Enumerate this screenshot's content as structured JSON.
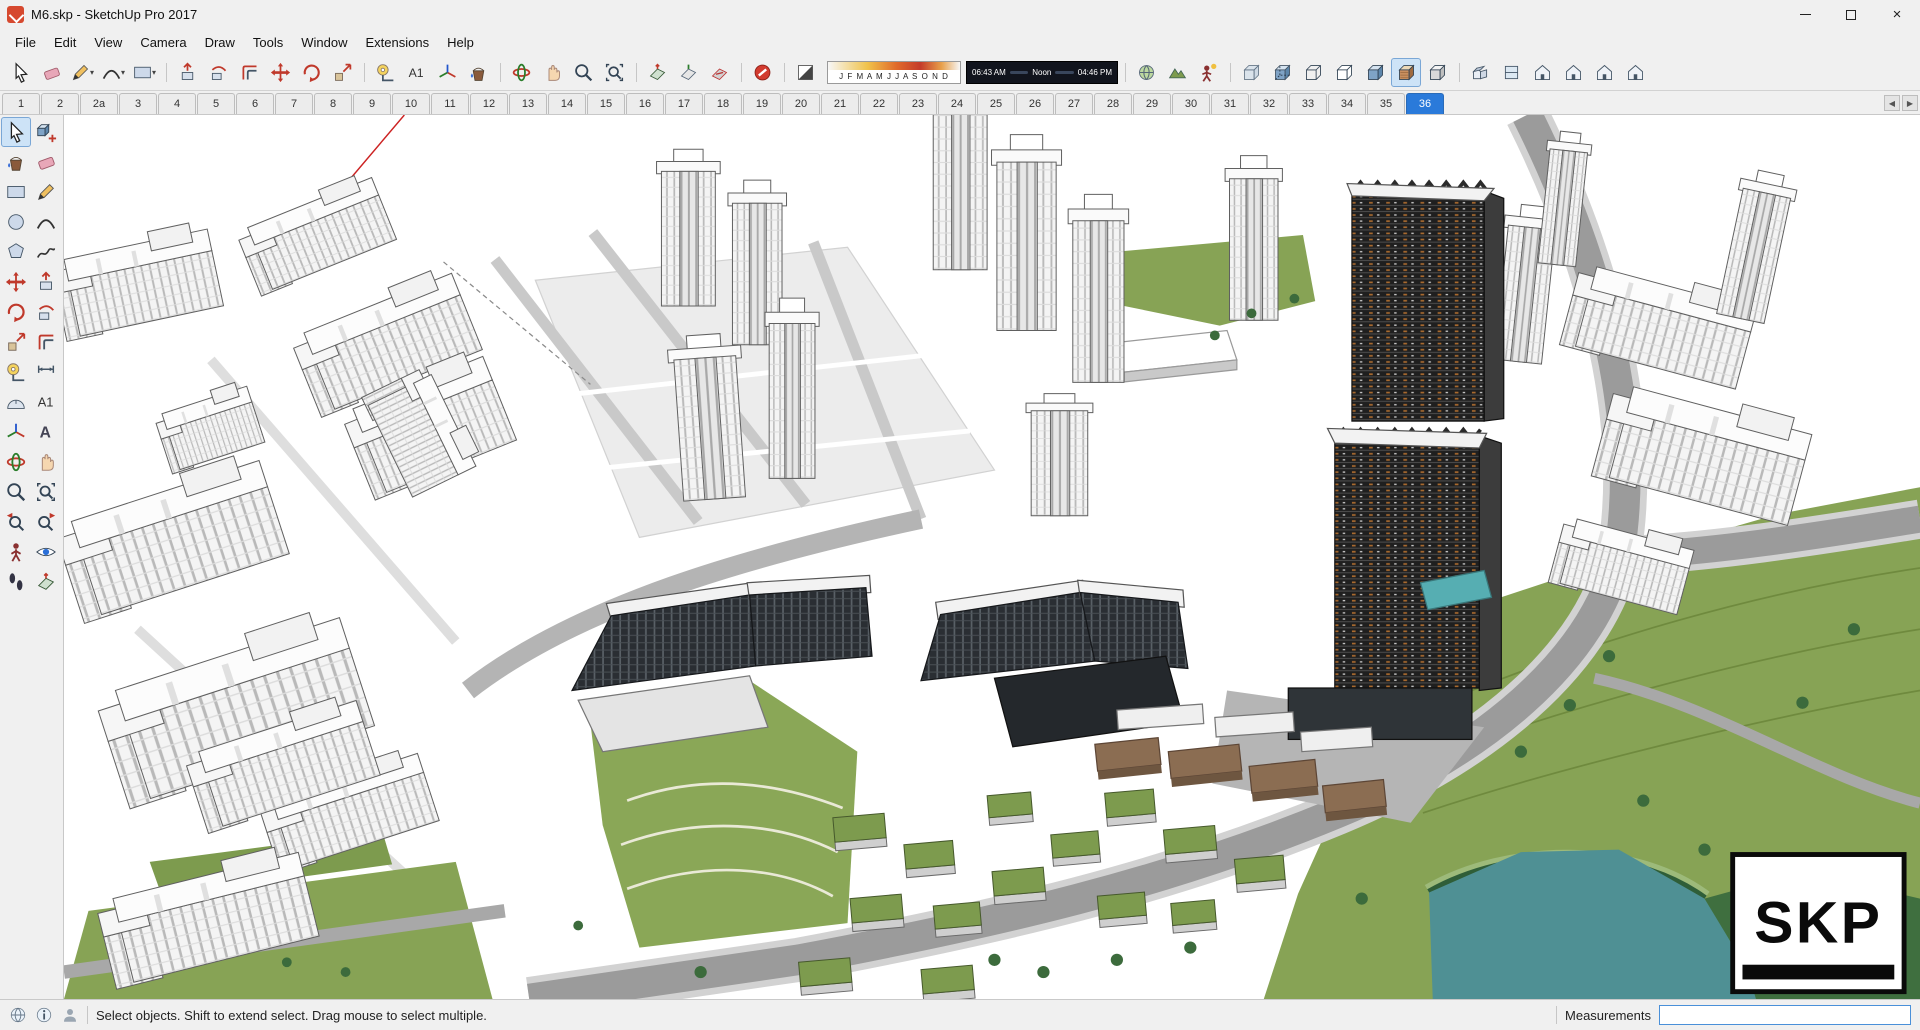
{
  "window": {
    "title": "M6.skp - SketchUp Pro 2017",
    "close_glyph": "×"
  },
  "menu": {
    "items": [
      {
        "id": "menu-file",
        "label": "File"
      },
      {
        "id": "menu-edit",
        "label": "Edit"
      },
      {
        "id": "menu-view",
        "label": "View"
      },
      {
        "id": "menu-camera",
        "label": "Camera"
      },
      {
        "id": "menu-draw",
        "label": "Draw"
      },
      {
        "id": "menu-tools",
        "label": "Tools"
      },
      {
        "id": "menu-window",
        "label": "Window"
      },
      {
        "id": "menu-extensions",
        "label": "Extensions"
      },
      {
        "id": "menu-help",
        "label": "Help"
      }
    ]
  },
  "toolbar": {
    "buttons_a": [
      {
        "name": "select-button",
        "icon": "#i-cursor",
        "icon_name": "cursor-icon"
      },
      {
        "name": "eraser-button",
        "icon": "#i-eraser",
        "icon_name": "eraser-icon"
      },
      {
        "name": "line-button",
        "icon": "#i-pencil",
        "icon_name": "pencil-icon",
        "dropdown": true
      },
      {
        "name": "arcs-button",
        "icon": "#i-arc",
        "icon_name": "arc-icon",
        "dropdown": true
      },
      {
        "name": "shapes-button",
        "icon": "#i-rect",
        "icon_name": "rectangle-icon",
        "dropdown": true
      },
      {
        "name": "push-pull-button",
        "icon": "#i-pushpull",
        "icon_name": "push-pull-icon",
        "sep": true
      },
      {
        "name": "follow-me-button",
        "icon": "#i-followme",
        "icon_name": "follow-me-icon"
      },
      {
        "name": "offset-button",
        "icon": "#i-offset",
        "icon_name": "offset-icon"
      },
      {
        "name": "move-button",
        "icon": "#i-move",
        "icon_name": "move-icon"
      },
      {
        "name": "rotate-button",
        "icon": "#i-rotate",
        "icon_name": "rotate-icon"
      },
      {
        "name": "scale-button",
        "icon": "#i-scale",
        "icon_name": "scale-icon"
      },
      {
        "name": "tape-measure-button",
        "icon": "#i-tape",
        "icon_name": "tape-measure-icon",
        "sep": true
      },
      {
        "name": "text-button",
        "icon": "#i-text",
        "icon_name": "text-icon"
      },
      {
        "name": "axes-button",
        "icon": "#i-axes",
        "icon_name": "axes-icon"
      },
      {
        "name": "paint-bucket-button",
        "icon": "#i-bucket",
        "icon_name": "paint-bucket-icon"
      },
      {
        "name": "orbit-button",
        "icon": "#i-orbit",
        "icon_name": "orbit-icon",
        "sep": true
      },
      {
        "name": "pan-button",
        "icon": "#i-pan",
        "icon_name": "pan-icon"
      },
      {
        "name": "zoom-button",
        "icon": "#i-zoom",
        "icon_name": "zoom-icon"
      },
      {
        "name": "zoom-extents-button",
        "icon": "#i-zoomext",
        "icon_name": "zoom-extents-icon"
      },
      {
        "name": "section-plane-button",
        "icon": "#i-section",
        "icon_name": "section-plane-icon",
        "sep": true
      },
      {
        "name": "section-display-button",
        "icon": "#i-secdisp",
        "icon_name": "section-display-icon"
      },
      {
        "name": "section-cuts-button",
        "icon": "#i-seccut",
        "icon_name": "section-cuts-icon"
      },
      {
        "name": "render-plugin-button",
        "icon": "#i-red",
        "icon_name": "red-badge-icon",
        "sep": true
      },
      {
        "name": "shadow-settings-button",
        "icon": "#i-shadowbox",
        "icon_name": "shadow-toggle-icon",
        "sep": true
      }
    ],
    "shadow": {
      "months": "J F M A M J J A S O N D",
      "time_start": "06:43 AM",
      "time_noon": "Noon",
      "time_end": "04:46 PM"
    },
    "buttons_b": [
      {
        "name": "add-location-button",
        "icon": "#i-geoloc",
        "icon_name": "globe-icon",
        "sep": true
      },
      {
        "name": "toggle-terrain-button",
        "icon": "#i-terrain",
        "icon_name": "terrain-icon"
      },
      {
        "name": "photo-textures-button",
        "icon": "#i-photo",
        "icon_name": "photo-person-icon"
      },
      {
        "name": "style-xray-button",
        "icon": "#i-xray",
        "icon_name": "xray-cube-icon",
        "sep": true
      },
      {
        "name": "style-back-edges-button",
        "icon": "#i-backedge",
        "icon_name": "back-edges-cube-icon"
      },
      {
        "name": "style-wireframe-button",
        "icon": "#i-wire",
        "icon_name": "wireframe-cube-icon"
      },
      {
        "name": "style-hidden-line-button",
        "icon": "#i-hidden",
        "icon_name": "hidden-line-cube-icon"
      },
      {
        "name": "style-shaded-button",
        "icon": "#i-shaded",
        "icon_name": "shaded-cube-icon"
      },
      {
        "name": "style-shaded-textures-button",
        "icon": "#i-textured",
        "icon_name": "textured-cube-icon",
        "pressed": true
      },
      {
        "name": "style-monochrome-button",
        "icon": "#i-mono",
        "icon_name": "monochrome-cube-icon"
      },
      {
        "name": "view-iso-button",
        "icon": "#i-viewiso",
        "icon_name": "iso-house-icon",
        "sep": true
      },
      {
        "name": "view-top-button",
        "icon": "#i-viewtop",
        "icon_name": "top-plan-icon"
      },
      {
        "name": "view-front-button",
        "icon": "#i-house",
        "icon_name": "front-house-icon"
      },
      {
        "name": "view-right-button",
        "icon": "#i-house",
        "icon_name": "right-house-icon"
      },
      {
        "name": "view-back-button",
        "icon": "#i-house",
        "icon_name": "back-house-icon"
      },
      {
        "name": "view-left-button",
        "icon": "#i-house",
        "icon_name": "left-house-icon"
      }
    ]
  },
  "scene_tabs": {
    "scroll_left": "◀",
    "scroll_right": "▶",
    "tabs": [
      {
        "label": "1"
      },
      {
        "label": "2"
      },
      {
        "label": "2a"
      },
      {
        "label": "3"
      },
      {
        "label": "4"
      },
      {
        "label": "5"
      },
      {
        "label": "6"
      },
      {
        "label": "7"
      },
      {
        "label": "8"
      },
      {
        "label": "9"
      },
      {
        "label": "10"
      },
      {
        "label": "11"
      },
      {
        "label": "12"
      },
      {
        "label": "13"
      },
      {
        "label": "14"
      },
      {
        "label": "15"
      },
      {
        "label": "16"
      },
      {
        "label": "17"
      },
      {
        "label": "18"
      },
      {
        "label": "19"
      },
      {
        "label": "20"
      },
      {
        "label": "21"
      },
      {
        "label": "22"
      },
      {
        "label": "23"
      },
      {
        "label": "24"
      },
      {
        "label": "25"
      },
      {
        "label": "26"
      },
      {
        "label": "27"
      },
      {
        "label": "28"
      },
      {
        "label": "29"
      },
      {
        "label": "30"
      },
      {
        "label": "31"
      },
      {
        "label": "32"
      },
      {
        "label": "33"
      },
      {
        "label": "34"
      },
      {
        "label": "35"
      },
      {
        "label": "36",
        "active": true
      }
    ]
  },
  "palette": {
    "tools": [
      {
        "name": "palette-select-button",
        "icon": "#i-cursor",
        "icon_name": "cursor-icon",
        "pressed": true
      },
      {
        "name": "palette-make-component-button",
        "icon": "#i-component",
        "icon_name": "component-icon"
      },
      {
        "name": "palette-paint-bucket-button",
        "icon": "#i-bucket",
        "icon_name": "paint-bucket-icon"
      },
      {
        "name": "palette-eraser-button",
        "icon": "#i-eraser",
        "icon_name": "eraser-icon"
      },
      {
        "name": "palette-rectangle-button",
        "icon": "#i-rect",
        "icon_name": "rectangle-icon"
      },
      {
        "name": "palette-line-button",
        "icon": "#i-pencil",
        "icon_name": "pencil-icon"
      },
      {
        "name": "palette-circle-button",
        "icon": "#i-circle",
        "icon_name": "circle-icon"
      },
      {
        "name": "palette-arc-button",
        "icon": "#i-arc",
        "icon_name": "arc-icon"
      },
      {
        "name": "palette-polygon-button",
        "icon": "#i-polygon",
        "icon_name": "polygon-icon"
      },
      {
        "name": "palette-freehand-button",
        "icon": "#i-freehand",
        "icon_name": "freehand-icon"
      },
      {
        "name": "palette-move-button",
        "icon": "#i-move",
        "icon_name": "move-icon"
      },
      {
        "name": "palette-push-pull-button",
        "icon": "#i-pushpull",
        "icon_name": "push-pull-icon"
      },
      {
        "name": "palette-rotate-button",
        "icon": "#i-rotate",
        "icon_name": "rotate-icon"
      },
      {
        "name": "palette-follow-me-button",
        "icon": "#i-followme",
        "icon_name": "follow-me-icon"
      },
      {
        "name": "palette-scale-button",
        "icon": "#i-scale",
        "icon_name": "scale-icon"
      },
      {
        "name": "palette-offset-button",
        "icon": "#i-offset",
        "icon_name": "offset-icon"
      },
      {
        "name": "palette-tape-measure-button",
        "icon": "#i-tape",
        "icon_name": "tape-measure-icon"
      },
      {
        "name": "palette-dimension-button",
        "icon": "#i-dim",
        "icon_name": "dimension-icon"
      },
      {
        "name": "palette-protractor-button",
        "icon": "#i-protract",
        "icon_name": "protractor-icon"
      },
      {
        "name": "palette-text-button",
        "icon": "#i-text",
        "icon_name": "text-icon"
      },
      {
        "name": "palette-axes-button",
        "icon": "#i-axes",
        "icon_name": "axes-icon"
      },
      {
        "name": "palette-3d-text-button",
        "icon": "#i-3dtext",
        "icon_name": "3d-text-icon"
      },
      {
        "name": "palette-orbit-button",
        "icon": "#i-orbit",
        "icon_name": "orbit-icon"
      },
      {
        "name": "palette-pan-button",
        "icon": "#i-pan",
        "icon_name": "pan-icon"
      },
      {
        "name": "palette-zoom-button",
        "icon": "#i-zoom",
        "icon_name": "zoom-icon"
      },
      {
        "name": "palette-zoom-extents-button",
        "icon": "#i-zoomext",
        "icon_name": "zoom-extents-icon"
      },
      {
        "name": "palette-zoom-previous-button",
        "icon": "#i-zoomprev",
        "icon_name": "zoom-previous-icon"
      },
      {
        "name": "palette-zoom-next-button",
        "icon": "#i-zoomnext",
        "icon_name": "zoom-next-icon"
      },
      {
        "name": "palette-position-camera-button",
        "icon": "#i-campos",
        "icon_name": "position-camera-icon"
      },
      {
        "name": "palette-look-around-button",
        "icon": "#i-look",
        "icon_name": "look-around-icon"
      },
      {
        "name": "palette-walk-button",
        "icon": "#i-walk",
        "icon_name": "walk-icon"
      },
      {
        "name": "palette-section-plane-button",
        "icon": "#i-section",
        "icon_name": "section-plane-icon"
      }
    ]
  },
  "viewport": {
    "watermark": "SKP"
  },
  "statusbar": {
    "icons": [
      {
        "name": "geolocation-status-button",
        "icon": "#s-globe",
        "icon_name": "globe-icon"
      },
      {
        "name": "credits-status-button",
        "icon": "#s-info",
        "icon_name": "info-icon"
      },
      {
        "name": "sign-in-status-button",
        "icon": "#s-person",
        "icon_name": "person-icon"
      }
    ],
    "hint": "Select objects. Shift to extend select. Drag mouse to select multiple.",
    "measurements_label": "Measurements",
    "measurements_value": ""
  },
  "colors": {
    "accent": "#2a7ada",
    "green": "#87a355",
    "green_roof": "#7d9b4e",
    "dark_facade": "#1f1f1f",
    "lake": "#4f9094",
    "road": "#9b9b9b"
  }
}
